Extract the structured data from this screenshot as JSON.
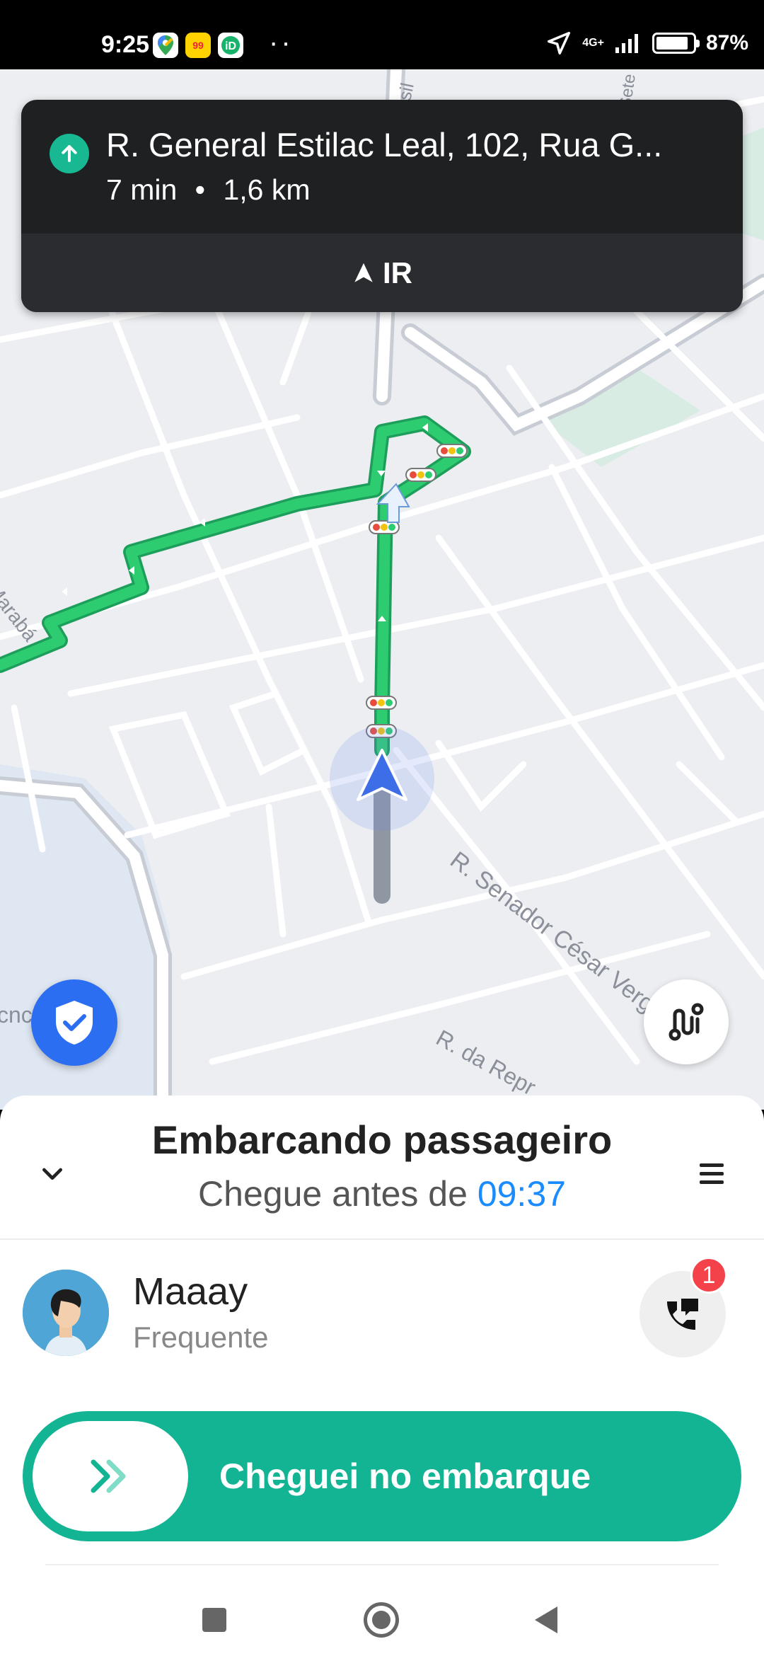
{
  "status_bar": {
    "time": "9:25",
    "app_icons": [
      "maps-icon",
      "99-app-icon",
      "id-app-icon"
    ],
    "network": "4G+",
    "battery": "87%",
    "battery_level": 0.87
  },
  "map": {
    "street_labels": {
      "brasil": "Brasil",
      "sete": "R. Sete",
      "maraba": "Marabá",
      "senador": "R. Senador César Vergueiro",
      "repr": "R. da Repr",
      "cnc": "cnc"
    }
  },
  "navigation": {
    "address": "R. General Estilac Leal, 102, Rua G...",
    "duration": "7 min",
    "separator": "•",
    "distance": "1,6 km",
    "go_label": "IR",
    "accent": "#17b892"
  },
  "sheet": {
    "title": "Embarcando passageiro",
    "subtitle_prefix": "Chegue antes de",
    "deadline": "09:37",
    "passenger": {
      "name": "Maaay",
      "tag": "Frequente"
    },
    "call_badge": "1",
    "slide_button_label": "Cheguei no embarque",
    "primary_color": "#13b493"
  }
}
